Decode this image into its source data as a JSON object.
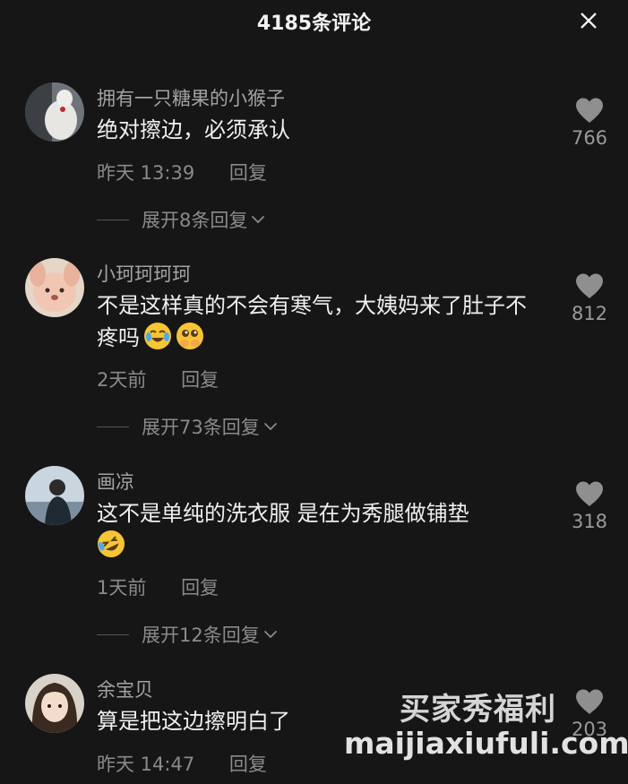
{
  "header": {
    "title": "4185条评论",
    "close_icon": "close-icon"
  },
  "comments": [
    {
      "username": "拥有一只糖果的小猴子",
      "text": "绝对擦边，必须承认",
      "time": "昨天 13:39",
      "reply": "回复",
      "expand": "展开8条回复",
      "likes": "766"
    },
    {
      "username": "小珂珂珂珂",
      "text": "不是这样真的不会有寒气，大姨妈来了肚子不疼吗",
      "emojis": [
        "crying-laughing-emoji",
        "pleading-emoji"
      ],
      "time": "2天前",
      "reply": "回复",
      "expand": "展开73条回复",
      "likes": "812"
    },
    {
      "username": "画凉",
      "text": "这不是单纯的洗衣服 是在为秀腿做铺垫",
      "emojis": [
        "rolling-laughing-emoji"
      ],
      "time": "1天前",
      "reply": "回复",
      "expand": "展开12条回复",
      "likes": "318"
    },
    {
      "username": "余宝贝",
      "text": "算是把这边擦明白了",
      "time": "昨天 14:47",
      "reply": "回复",
      "likes": "203"
    }
  ],
  "watermark": {
    "line1": "买家秀福利",
    "line2": "maijiaxiufuli.com"
  },
  "colors": {
    "background": "#161616",
    "text": "#f0f0f0",
    "muted": "#8a8a8a",
    "heart": "#8f8f8f"
  }
}
